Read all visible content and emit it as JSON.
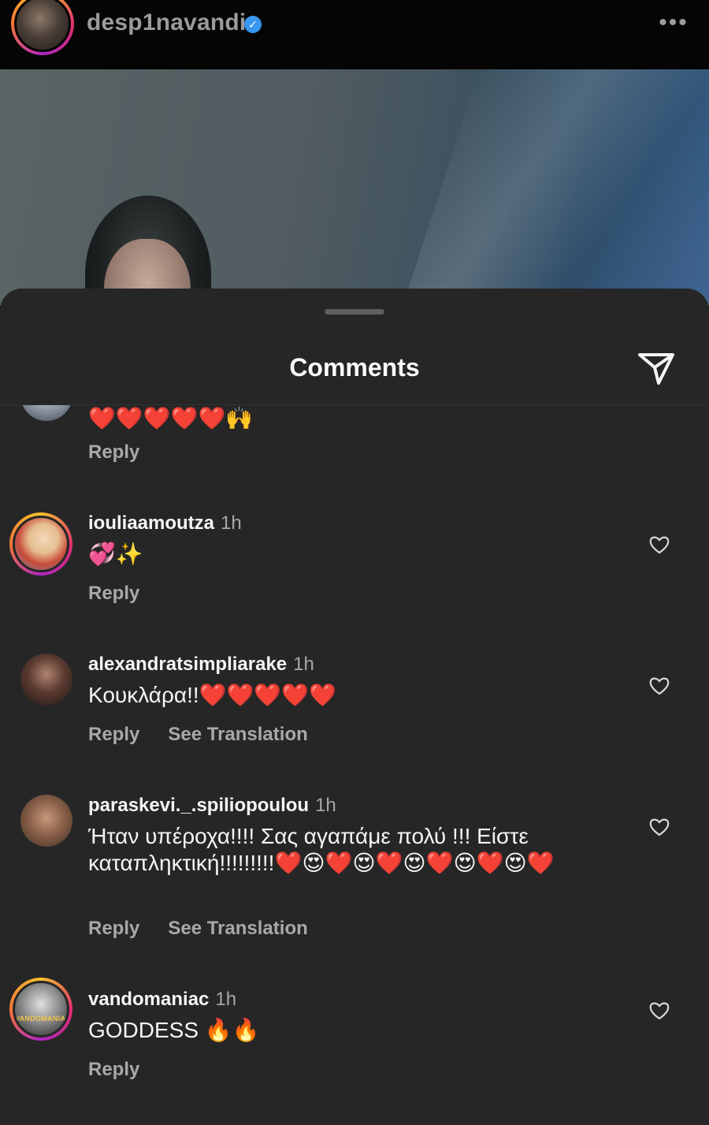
{
  "header": {
    "username": "desp1navandi",
    "verified_glyph": "✓",
    "more_glyph": "•••"
  },
  "sheet": {
    "title": "Comments",
    "share_icon": "paper-plane-icon"
  },
  "comments": [
    {
      "username": "",
      "time": "",
      "text": "❤️❤️❤️❤️❤️🙌",
      "reply_label": "Reply",
      "translation_label": ""
    },
    {
      "username": "iouliaamoutza",
      "time": "1h",
      "text": "💞✨",
      "reply_label": "Reply",
      "translation_label": ""
    },
    {
      "username": "alexandratsimpliarake",
      "time": "1h",
      "text": "Κουκλάρα!!❤️❤️❤️❤️❤️",
      "reply_label": "Reply",
      "translation_label": "See Translation"
    },
    {
      "username": "paraskevi._.spiliopoulou",
      "time": "1h",
      "text": "Ήταν υπέροχα!!!! Σας αγαπάμε πολύ !!! Είστε καταπληκτική!!!!!!!!!❤️😍❤️😍❤️😍❤️😍❤️😍❤️",
      "reply_label": "Reply",
      "translation_label": "See Translation"
    },
    {
      "username": "vandomaniac",
      "time": "1h",
      "text": "GODDESS 🔥🔥",
      "reply_label": "Reply",
      "translation_label": "",
      "avatar_text": "VANDOMANIAC"
    }
  ],
  "colors": {
    "sheet_bg": "#262626",
    "secondary_text": "#a8a8a8",
    "verified": "#3897f0"
  }
}
